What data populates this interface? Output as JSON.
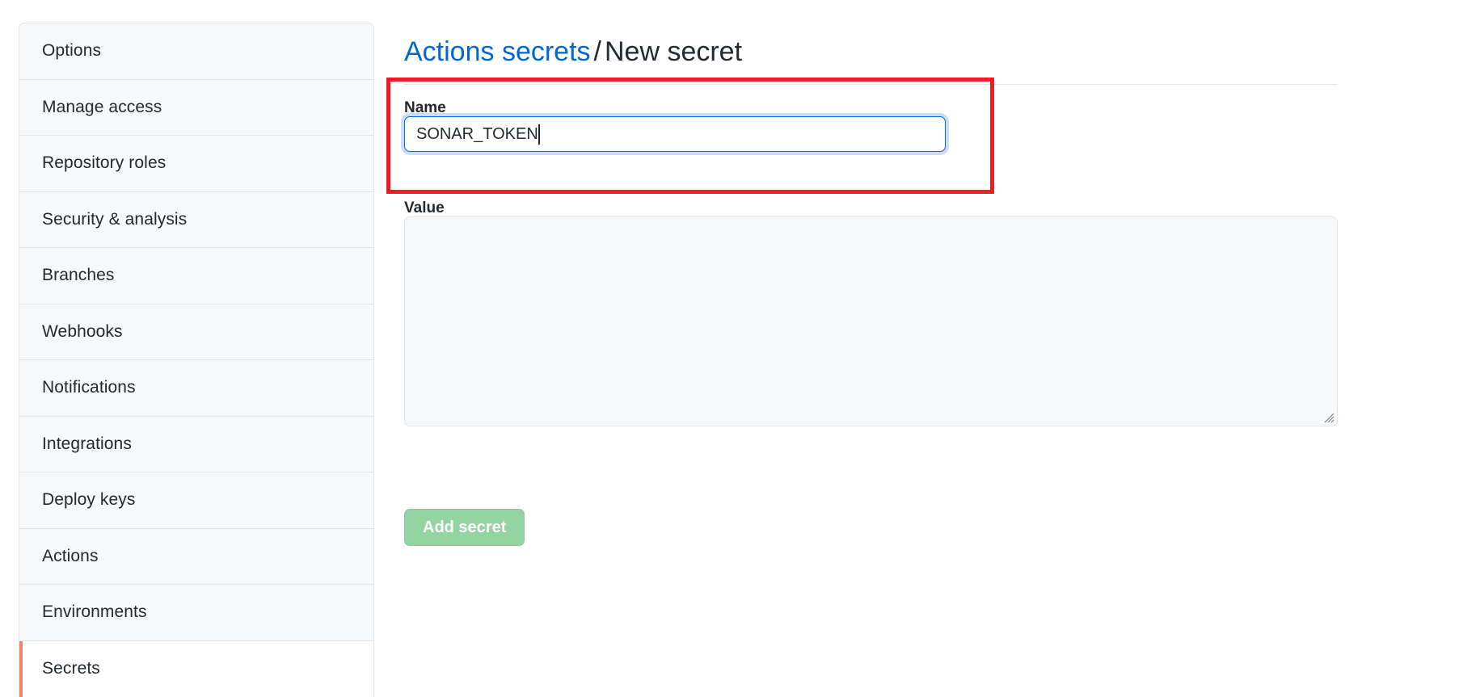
{
  "sidebar": {
    "items": [
      {
        "label": "Options",
        "selected": false
      },
      {
        "label": "Manage access",
        "selected": false
      },
      {
        "label": "Repository roles",
        "selected": false
      },
      {
        "label": "Security & analysis",
        "selected": false
      },
      {
        "label": "Branches",
        "selected": false
      },
      {
        "label": "Webhooks",
        "selected": false
      },
      {
        "label": "Notifications",
        "selected": false
      },
      {
        "label": "Integrations",
        "selected": false
      },
      {
        "label": "Deploy keys",
        "selected": false
      },
      {
        "label": "Actions",
        "selected": false
      },
      {
        "label": "Environments",
        "selected": false
      },
      {
        "label": "Secrets",
        "selected": true
      }
    ],
    "selected_accent": "#f9826c"
  },
  "header": {
    "breadcrumb_link": "Actions secrets",
    "breadcrumb_separator": "/",
    "breadcrumb_current": "New secret",
    "link_color": "#0366d6"
  },
  "form": {
    "name": {
      "label": "Name",
      "value": "SONAR_TOKEN",
      "placeholder": "",
      "focused": true,
      "focus_border_color": "#0366d6"
    },
    "value": {
      "label": "Value",
      "value": "",
      "placeholder": ""
    },
    "submit": {
      "label": "Add secret",
      "enabled": false,
      "color": "#94d3a2"
    },
    "resize_handle_icon": "resize-grip-icon"
  },
  "annotation": {
    "color": "#ee1c25",
    "target": "name-field-group"
  }
}
